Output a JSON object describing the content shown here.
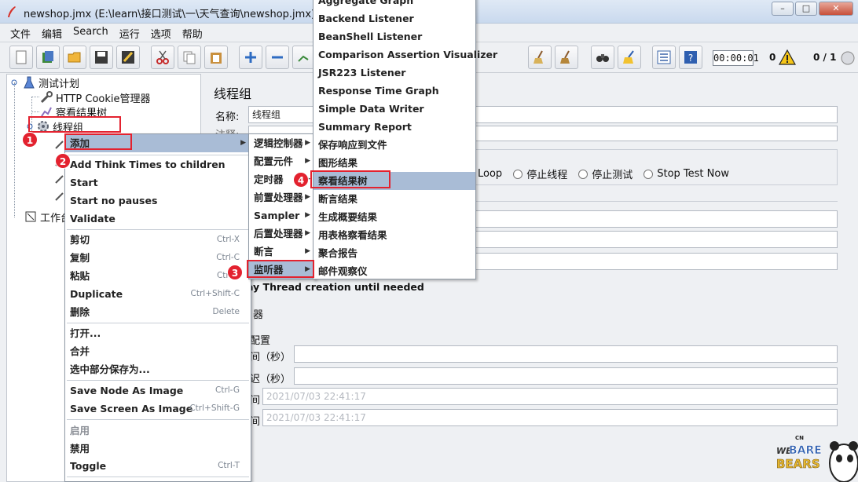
{
  "window": {
    "title": "newshop.jmx (E:\\learn\\接口测试\\一\\天气查询\\newshop.jmx) - Apa",
    "minimize": "–",
    "maximize": "□",
    "close": "✕"
  },
  "menubar": [
    "文件",
    "编辑",
    "Search",
    "运行",
    "选项",
    "帮助"
  ],
  "toolbar": {
    "timer": "00:00:01",
    "warn_count": "0",
    "thread_count": "0 / 1"
  },
  "tree": {
    "root": "测试计划",
    "items": [
      "HTTP Cookie管理器",
      "察看结果树",
      "线程组"
    ],
    "workbench": "工作台"
  },
  "panel": {
    "title": "线程组",
    "name_label": "名称:",
    "name_value": "线程组",
    "comment_label": "注释:",
    "radios": [
      "Loop",
      "停止线程",
      "停止测试",
      "Stop Test Now"
    ],
    "delay_text": "ay Thread creation until needed",
    "scheduler_text": "器",
    "config_title": "配置",
    "duration_label": "间（秒）",
    "startup_label": "迟（秒）",
    "start_label": "间",
    "end_label": "间",
    "start_time": "2021/07/03 22:41:17",
    "end_time": "2021/07/03 22:41:17"
  },
  "menu1": {
    "items": [
      {
        "label": "添加",
        "submenu": true
      },
      {
        "label": "Add Think Times to children"
      },
      {
        "label": "Start"
      },
      {
        "label": "Start no pauses"
      },
      {
        "label": "Validate"
      },
      {
        "label": "剪切",
        "shortcut": "Ctrl-X"
      },
      {
        "label": "复制",
        "shortcut": "Ctrl-C"
      },
      {
        "label": "粘贴",
        "shortcut": "Ctrl-V"
      },
      {
        "label": "Duplicate",
        "shortcut": "Ctrl+Shift-C"
      },
      {
        "label": "删除",
        "shortcut": "Delete"
      },
      {
        "label": "打开..."
      },
      {
        "label": "合并"
      },
      {
        "label": "选中部分保存为..."
      },
      {
        "label": "Save Node As Image",
        "shortcut": "Ctrl-G"
      },
      {
        "label": "Save Screen As Image",
        "shortcut": "Ctrl+Shift-G"
      },
      {
        "label": "启用"
      },
      {
        "label": "禁用"
      },
      {
        "label": "Toggle",
        "shortcut": "Ctrl-T"
      }
    ]
  },
  "menu2": {
    "items": [
      "逻辑控制器",
      "配置元件",
      "定时器",
      "前置处理器",
      "Sampler",
      "后置处理器",
      "断言",
      "监听器"
    ]
  },
  "menu3": {
    "items": [
      "Aggregate Graph",
      "Backend Listener",
      "BeanShell Listener",
      "Comparison Assertion Visualizer",
      "JSR223 Listener",
      "Response Time Graph",
      "Simple Data Writer",
      "Summary Report",
      "保存响应到文件",
      "图形结果",
      "察看结果树",
      "断言结果",
      "生成概要结果",
      "用表格察看结果",
      "聚合报告",
      "邮件观察仪"
    ]
  },
  "badges": [
    "1",
    "2",
    "3",
    "4"
  ],
  "logo": {
    "top": "WE",
    "middle": "BARE",
    "bottom": "BEARS",
    "mark": "CN"
  },
  "colors": {
    "highlight": "#a9bcd6",
    "annotation": "#e3222f"
  }
}
